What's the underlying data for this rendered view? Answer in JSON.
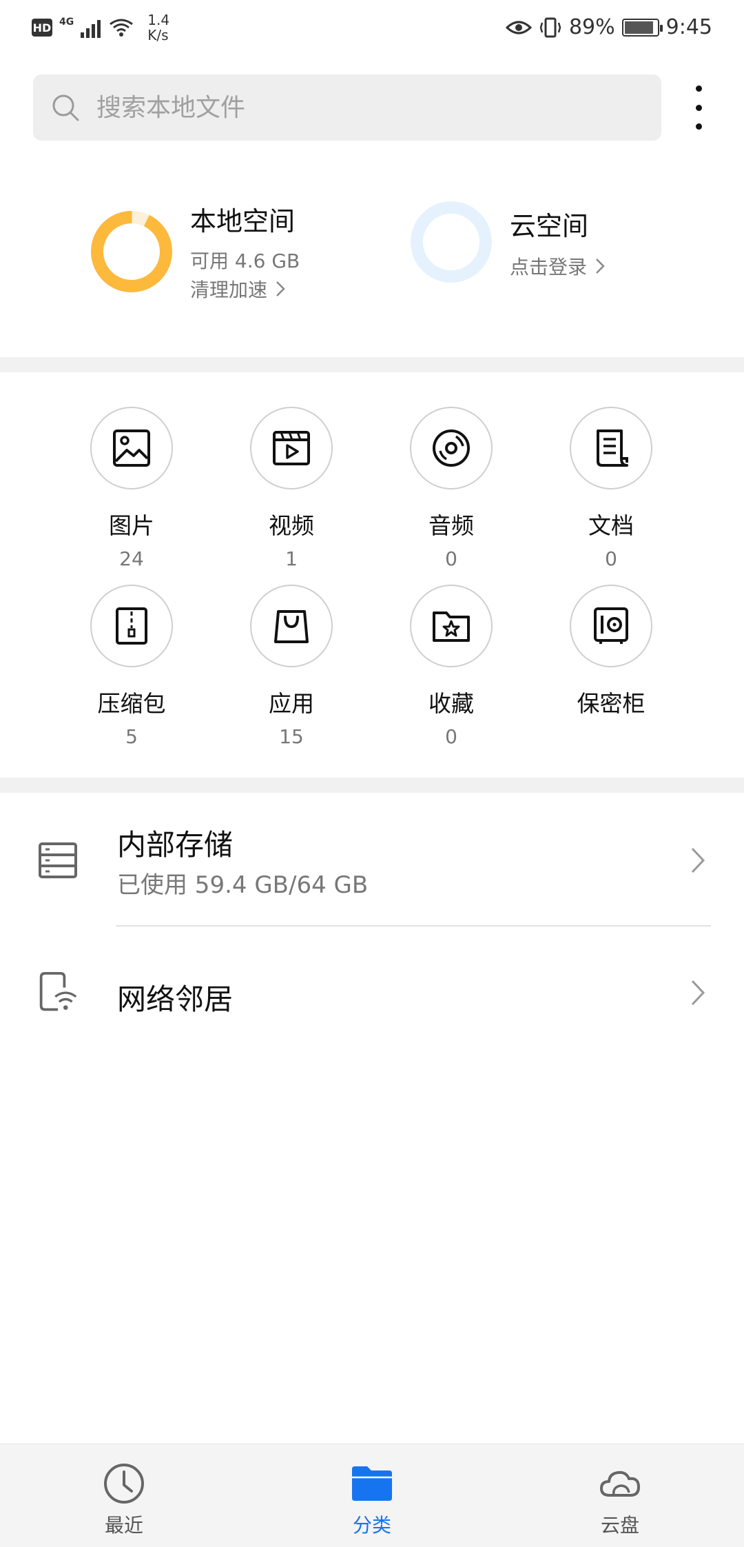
{
  "status_bar": {
    "hd_badge": "HD",
    "network": "4G",
    "net_speed_value": "1.4",
    "net_speed_unit": "K/s",
    "battery_percent": "89%",
    "battery_level": 0.89,
    "time": "9:45",
    "icons": [
      "eye-icon",
      "vibrate-icon",
      "battery-icon",
      "wifi-icon",
      "signal-icon"
    ]
  },
  "search": {
    "placeholder": "搜索本地文件",
    "value": ""
  },
  "storage_summary": {
    "local": {
      "title": "本地空间",
      "available": "可用 4.6 GB",
      "action": "清理加速",
      "used_fraction": 0.928,
      "ring_color": "#FDB93C",
      "ring_track": "#FBF0D8"
    },
    "cloud": {
      "title": "云空间",
      "action": "点击登录",
      "ring_color": "#E5F2FE"
    }
  },
  "categories": [
    {
      "label": "图片",
      "count": "24",
      "icon": "image-icon"
    },
    {
      "label": "视频",
      "count": "1",
      "icon": "video-icon"
    },
    {
      "label": "音频",
      "count": "0",
      "icon": "audio-icon"
    },
    {
      "label": "文档",
      "count": "0",
      "icon": "document-icon"
    },
    {
      "label": "压缩包",
      "count": "5",
      "icon": "archive-icon"
    },
    {
      "label": "应用",
      "count": "15",
      "icon": "app-bag-icon"
    },
    {
      "label": "收藏",
      "count": "0",
      "icon": "favorite-folder-icon"
    },
    {
      "label": "保密柜",
      "count": "",
      "icon": "safe-icon"
    }
  ],
  "locations": [
    {
      "title": "内部存储",
      "subtitle": "已使用 59.4 GB/64 GB",
      "icon": "storage-icon"
    },
    {
      "title": "网络邻居",
      "subtitle": "",
      "icon": "network-device-icon"
    }
  ],
  "bottom_nav": {
    "items": [
      {
        "label": "最近",
        "icon": "clock-icon",
        "active": false
      },
      {
        "label": "分类",
        "icon": "folder-icon",
        "active": true
      },
      {
        "label": "云盘",
        "icon": "cloud-icon",
        "active": false
      }
    ],
    "active_color": "#1774F0"
  }
}
